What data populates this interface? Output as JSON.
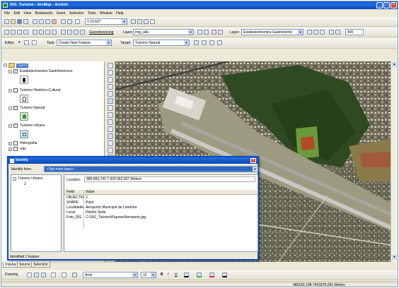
{
  "window": {
    "title": "SIG_Turismo - ArcMap - ArcInfo"
  },
  "menu": [
    "File",
    "Edit",
    "View",
    "Bookmarks",
    "Insert",
    "Selection",
    "Tools",
    "Window",
    "Help"
  ],
  "standard_toolbar": {
    "scale": "1:10.637"
  },
  "georef_toolbar": {
    "label": "Georeferencing",
    "layer_label": "Layer:",
    "layer_value": "img_alta"
  },
  "effects_toolbar": {
    "layer_label": "Layer:",
    "layer_value": "Estabelecimentos Gastrônomic",
    "value": "400"
  },
  "editor_toolbar": {
    "editor_label": "Editor",
    "task_label": "Task:",
    "task_value": "Create New Feature",
    "target_label": "Target:",
    "target_value": "Turismo Natural"
  },
  "toc": {
    "root": "Layers",
    "layers": [
      {
        "name": "Estabelecimentos Gastrônomicos",
        "checked": true
      },
      {
        "name": "Turismo Histórico-Cultural",
        "checked": false
      },
      {
        "name": "Turismo Natural",
        "checked": true
      },
      {
        "name": "Turismo Urbano",
        "checked": true
      },
      {
        "name": "Hidrografia",
        "checked": false
      },
      {
        "name": "vias",
        "checked": false
      }
    ]
  },
  "toc_tabs": [
    "Display",
    "Source",
    "Selection"
  ],
  "identify": {
    "title": "Identify",
    "from_label": "Identify from:",
    "from_value": "<Top-most layer>",
    "tree": [
      "Turismo Urbano",
      "2"
    ],
    "location_label": "Location:",
    "location_value": "485.969,743  7.420.062,837 Meters",
    "columns": [
      "Field",
      "Value"
    ],
    "rows": [
      [
        "OBJECTID",
        "2"
      ],
      [
        "SHAPE",
        "Point"
      ],
      [
        "Localidade",
        "Aeroporto Municipal de Londrina"
      ],
      [
        "Local",
        "Distrito Sede"
      ],
      [
        "Foto_SIG",
        "C:\\SIG_Turismo\\Figuras\\Aeroporto.jpg"
      ]
    ],
    "status": "Identified 1 feature"
  },
  "drawing_toolbar": {
    "label": "Drawing",
    "font": "Arial",
    "size": "10",
    "bold": "B",
    "italic": "I",
    "underline": "U"
  },
  "status_bar": {
    "coords": "486162,198  7419375,091 Meters"
  },
  "colors": {
    "title_blue": "#0a5fd7",
    "selection_blue": "#316ac5",
    "chrome": "#ece9d8"
  }
}
